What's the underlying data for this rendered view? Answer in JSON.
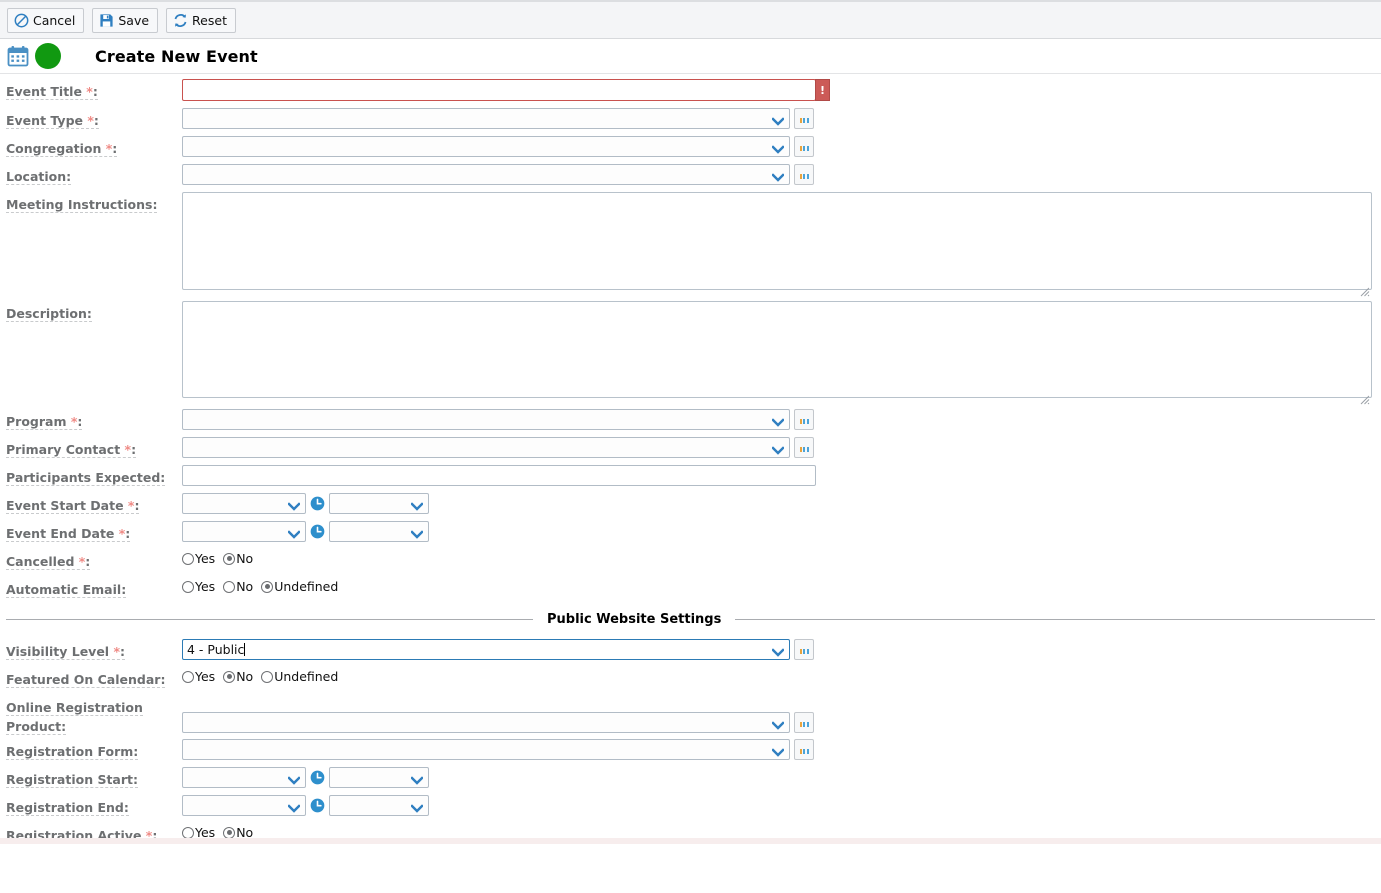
{
  "toolbar": {
    "buttons": [
      {
        "label": "Cancel",
        "icon": "cancel-icon"
      },
      {
        "label": "Save",
        "icon": "save-icon"
      },
      {
        "label": "Reset",
        "icon": "reset-icon"
      }
    ]
  },
  "header": {
    "title": "Create New Event",
    "calendar_icon": "calendar-icon",
    "status_icon": "green-circle-icon",
    "status_color": "#119911"
  },
  "colors": {
    "required_asterisk": "#ef8a85",
    "label_text": "#6d6f71",
    "error_border": "#c9524f",
    "error_badge": "#cc5a57",
    "focus_border": "#2c7bb5",
    "chevron": "#2f7fc1",
    "clock": "#2e8fcc"
  },
  "ellipsis_button": {
    "label": "...",
    "name": "lookup-button"
  },
  "fields": {
    "event_title": {
      "label": "Event Title",
      "required": true,
      "value": "",
      "error": true,
      "error_mark": "!"
    },
    "event_type": {
      "label": "Event Type",
      "required": true,
      "value": ""
    },
    "congregation": {
      "label": "Congregation",
      "required": true,
      "value": ""
    },
    "location": {
      "label": "Location",
      "required": false,
      "value": ""
    },
    "meeting_instructions": {
      "label": "Meeting Instructions",
      "required": false,
      "value": ""
    },
    "description": {
      "label": "Description",
      "required": false,
      "value": ""
    },
    "program": {
      "label": "Program",
      "required": true,
      "value": ""
    },
    "primary_contact": {
      "label": "Primary Contact",
      "required": true,
      "value": ""
    },
    "participants_expected": {
      "label": "Participants Expected",
      "required": false,
      "value": ""
    },
    "event_start_date": {
      "label": "Event Start Date",
      "required": true,
      "date_value": "",
      "time_value": ""
    },
    "event_end_date": {
      "label": "Event End Date",
      "required": true,
      "date_value": "",
      "time_value": ""
    },
    "cancelled": {
      "label": "Cancelled",
      "required": true,
      "options": [
        {
          "label": "Yes",
          "selected": false
        },
        {
          "label": "No",
          "selected": true
        }
      ]
    },
    "automatic_email": {
      "label": "Automatic Email",
      "required": false,
      "options": [
        {
          "label": "Yes",
          "selected": false
        },
        {
          "label": "No",
          "selected": false
        },
        {
          "label": "Undefined",
          "selected": true
        }
      ]
    },
    "visibility_level": {
      "label": "Visibility Level",
      "required": true,
      "value": "4 - Public",
      "focused": true
    },
    "featured_on_calendar": {
      "label": "Featured On Calendar",
      "required": false,
      "options": [
        {
          "label": "Yes",
          "selected": false
        },
        {
          "label": "No",
          "selected": true
        },
        {
          "label": "Undefined",
          "selected": false
        }
      ]
    },
    "online_registration_product": {
      "label": "Online Registration Product:",
      "required": false,
      "value": ""
    },
    "registration_form": {
      "label": "Registration Form",
      "required": false,
      "value": ""
    },
    "registration_start": {
      "label": "Registration Start",
      "required": false,
      "date_value": "",
      "time_value": ""
    },
    "registration_end": {
      "label": "Registration End",
      "required": false,
      "date_value": "",
      "time_value": ""
    },
    "registration_active": {
      "label": "Registration Active",
      "required": true,
      "options": [
        {
          "label": "Yes",
          "selected": false
        },
        {
          "label": "No",
          "selected": true
        }
      ]
    }
  },
  "sections": {
    "public_website": "Public Website Settings"
  }
}
